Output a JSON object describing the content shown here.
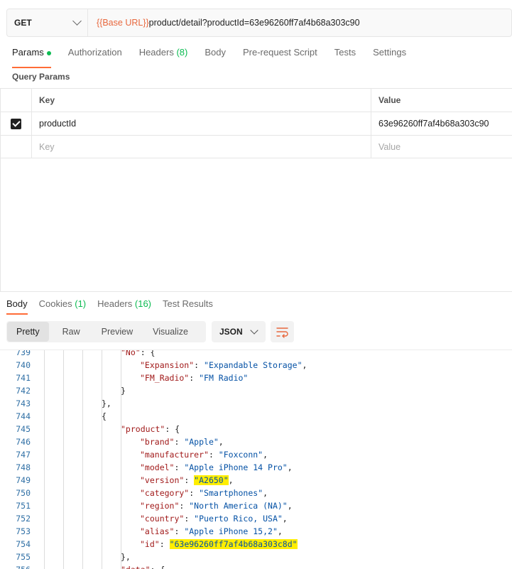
{
  "request": {
    "method": "GET",
    "url_variable": "{{Base URL}}",
    "url_path": "product/detail?productId=63e96260ff7af4b68a303c90"
  },
  "request_tabs": [
    {
      "label": "Params",
      "active": true,
      "dot": true
    },
    {
      "label": "Authorization"
    },
    {
      "label": "Headers",
      "count": "(8)"
    },
    {
      "label": "Body"
    },
    {
      "label": "Pre-request Script"
    },
    {
      "label": "Tests"
    },
    {
      "label": "Settings"
    }
  ],
  "query_params": {
    "title": "Query Params",
    "headers": {
      "key": "Key",
      "value": "Value"
    },
    "rows": [
      {
        "checked": true,
        "key": "productId",
        "value": "63e96260ff7af4b68a303c90"
      }
    ],
    "placeholder": {
      "key": "Key",
      "value": "Value"
    }
  },
  "response_tabs": [
    {
      "label": "Body",
      "active": true
    },
    {
      "label": "Cookies",
      "count": "(1)"
    },
    {
      "label": "Headers",
      "count": "(16)"
    },
    {
      "label": "Test Results"
    }
  ],
  "view_modes": [
    "Pretty",
    "Raw",
    "Preview",
    "Visualize"
  ],
  "active_view": "Pretty",
  "format": "JSON",
  "icons": {
    "format_chevron": "chevron-down-icon",
    "wrap": "wrap-lines-icon",
    "method_chevron": "chevron-down-icon"
  },
  "colors": {
    "accent": "#ff6c37",
    "url_variable": "#e8683e",
    "status_dot": "#0cbb52",
    "highlight": "#ffee00"
  },
  "code_lines": [
    {
      "n": "739",
      "indent": 4,
      "parts": [
        {
          "t": "\"No\"",
          "c": "key"
        },
        {
          "t": ": {"
        }
      ]
    },
    {
      "n": "740",
      "indent": 5,
      "parts": [
        {
          "t": "\"Expansion\"",
          "c": "key"
        },
        {
          "t": ": "
        },
        {
          "t": "\"Expandable Storage\"",
          "c": "str"
        },
        {
          "t": ","
        }
      ]
    },
    {
      "n": "741",
      "indent": 5,
      "parts": [
        {
          "t": "\"FM_Radio\"",
          "c": "key"
        },
        {
          "t": ": "
        },
        {
          "t": "\"FM Radio\"",
          "c": "str"
        }
      ]
    },
    {
      "n": "742",
      "indent": 4,
      "parts": [
        {
          "t": "}"
        }
      ]
    },
    {
      "n": "743",
      "indent": 3,
      "parts": [
        {
          "t": "},"
        }
      ]
    },
    {
      "n": "744",
      "indent": 3,
      "parts": [
        {
          "t": "{"
        }
      ]
    },
    {
      "n": "745",
      "indent": 4,
      "parts": [
        {
          "t": "\"product\"",
          "c": "key"
        },
        {
          "t": ": {"
        }
      ]
    },
    {
      "n": "746",
      "indent": 5,
      "parts": [
        {
          "t": "\"brand\"",
          "c": "key"
        },
        {
          "t": ": "
        },
        {
          "t": "\"Apple\"",
          "c": "str"
        },
        {
          "t": ","
        }
      ]
    },
    {
      "n": "747",
      "indent": 5,
      "parts": [
        {
          "t": "\"manufacturer\"",
          "c": "key"
        },
        {
          "t": ": "
        },
        {
          "t": "\"Foxconn\"",
          "c": "str"
        },
        {
          "t": ","
        }
      ]
    },
    {
      "n": "748",
      "indent": 5,
      "parts": [
        {
          "t": "\"model\"",
          "c": "key"
        },
        {
          "t": ": "
        },
        {
          "t": "\"Apple iPhone 14 Pro\"",
          "c": "str"
        },
        {
          "t": ","
        }
      ]
    },
    {
      "n": "749",
      "indent": 5,
      "parts": [
        {
          "t": "\"version\"",
          "c": "key"
        },
        {
          "t": ": "
        },
        {
          "t": "\"A2650\"",
          "c": "str hl"
        },
        {
          "t": ","
        }
      ]
    },
    {
      "n": "750",
      "indent": 5,
      "parts": [
        {
          "t": "\"category\"",
          "c": "key"
        },
        {
          "t": ": "
        },
        {
          "t": "\"Smartphones\"",
          "c": "str"
        },
        {
          "t": ","
        }
      ]
    },
    {
      "n": "751",
      "indent": 5,
      "parts": [
        {
          "t": "\"region\"",
          "c": "key"
        },
        {
          "t": ": "
        },
        {
          "t": "\"North America (NA)\"",
          "c": "str"
        },
        {
          "t": ","
        }
      ]
    },
    {
      "n": "752",
      "indent": 5,
      "parts": [
        {
          "t": "\"country\"",
          "c": "key"
        },
        {
          "t": ": "
        },
        {
          "t": "\"Puerto Rico, USA\"",
          "c": "str"
        },
        {
          "t": ","
        }
      ]
    },
    {
      "n": "753",
      "indent": 5,
      "parts": [
        {
          "t": "\"alias\"",
          "c": "key"
        },
        {
          "t": ": "
        },
        {
          "t": "\"Apple iPhone 15,2\"",
          "c": "str"
        },
        {
          "t": ","
        }
      ]
    },
    {
      "n": "754",
      "indent": 5,
      "parts": [
        {
          "t": "\"id\"",
          "c": "key"
        },
        {
          "t": ": "
        },
        {
          "t": "\"63e96260ff7af4b68a303c8d\"",
          "c": "str hl"
        }
      ]
    },
    {
      "n": "755",
      "indent": 4,
      "parts": [
        {
          "t": "},"
        }
      ]
    },
    {
      "n": "756",
      "indent": 4,
      "parts": [
        {
          "t": "\"data\"",
          "c": "key"
        },
        {
          "t": ": {"
        }
      ]
    }
  ]
}
